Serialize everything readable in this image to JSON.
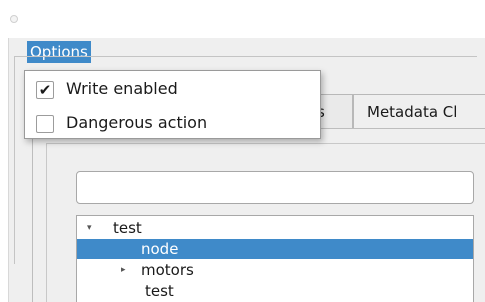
{
  "menubar": {
    "options_label": "Options"
  },
  "options_menu": {
    "items": [
      {
        "label": "Write enabled",
        "checked": true,
        "check_glyph": "✔"
      },
      {
        "label": "Dangerous action",
        "checked": false,
        "check_glyph": ""
      }
    ]
  },
  "tabs": [
    {
      "label": "s"
    },
    {
      "label": "Metadata Cl"
    }
  ],
  "search": {
    "value": "",
    "placeholder": ""
  },
  "tree": {
    "rows": [
      {
        "label": "test",
        "expander": "▾"
      },
      {
        "label": "node",
        "selected": true
      },
      {
        "label": "motors",
        "expander": "▸"
      },
      {
        "label": "test"
      }
    ]
  },
  "colors": {
    "selection": "#3f8ac9",
    "window_bg": "#efefef"
  }
}
